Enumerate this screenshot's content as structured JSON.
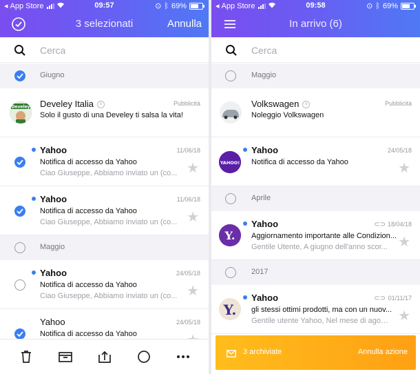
{
  "left": {
    "status": {
      "carrier": "App Store",
      "time": "09:57",
      "battery": "69%",
      "battery_level": 0.69
    },
    "nav": {
      "title": "3 selezionati",
      "action": "Annulla"
    },
    "search": {
      "placeholder": "Cerca"
    },
    "sections": [
      "Giugno",
      "Maggio"
    ],
    "ad": {
      "sender": "Develey Italia",
      "badge": "s",
      "label": "Pubblicità",
      "subject": "Solo il gusto di una Develey ti salsa la vita!"
    },
    "messages": [
      {
        "sender": "Yahoo",
        "date": "11/06/18",
        "subject": "Notifica di accesso da Yahoo",
        "preview": "Ciao Giuseppe, Abbiamo inviato un (co..."
      },
      {
        "sender": "Yahoo",
        "date": "11/06/18",
        "subject": "Notifica di accesso da Yahoo",
        "preview": "Ciao Giuseppe, Abbiamo inviato un (co..."
      },
      {
        "sender": "Yahoo",
        "date": "24/05/18",
        "subject": "Notifica di accesso da Yahoo",
        "preview": "Ciao Giuseppe, Abbiamo inviato un (co..."
      },
      {
        "sender": "Yahoo",
        "date": "24/05/18",
        "subject": "Notifica di accesso da Yahoo",
        "preview": ""
      }
    ],
    "toolbar": [
      "trash-icon",
      "archive-icon",
      "move-icon",
      "mark-icon",
      "more-icon"
    ]
  },
  "right": {
    "status": {
      "carrier": "App Store",
      "time": "09:58",
      "battery": "69%",
      "battery_level": 0.69
    },
    "nav": {
      "title": "In arrivo (6)"
    },
    "search": {
      "placeholder": "Cerca"
    },
    "sections": [
      "Maggio",
      "Aprile",
      "2017"
    ],
    "ad": {
      "sender": "Volkswagen",
      "badge": "s",
      "label": "Pubblicità",
      "subject": "Noleggio Volkswagen"
    },
    "messages": [
      {
        "sender": "Yahoo",
        "date": "24/05/18",
        "subject": "Notifica di accesso da Yahoo",
        "preview": ""
      },
      {
        "sender": "Yahoo",
        "date": "18/04/18",
        "subject": "Aggiornamento importante alle Condizion...",
        "preview": "Gentile Utente, A giugno dell'anno scor..."
      },
      {
        "sender": "Yahoo",
        "date": "01/11/17",
        "subject": "gli stessi ottimi prodotti, ma con un nuov...",
        "preview": "Gentile utente Yahoo, Nel mese di agos..."
      }
    ],
    "toast": {
      "text": "3 archiviate",
      "action": "Annulla azione"
    }
  },
  "colors": {
    "header_start": "#7a4df0",
    "header_end": "#4f79f5",
    "accent": "#3b7ef0",
    "toast": "#ffad17"
  }
}
